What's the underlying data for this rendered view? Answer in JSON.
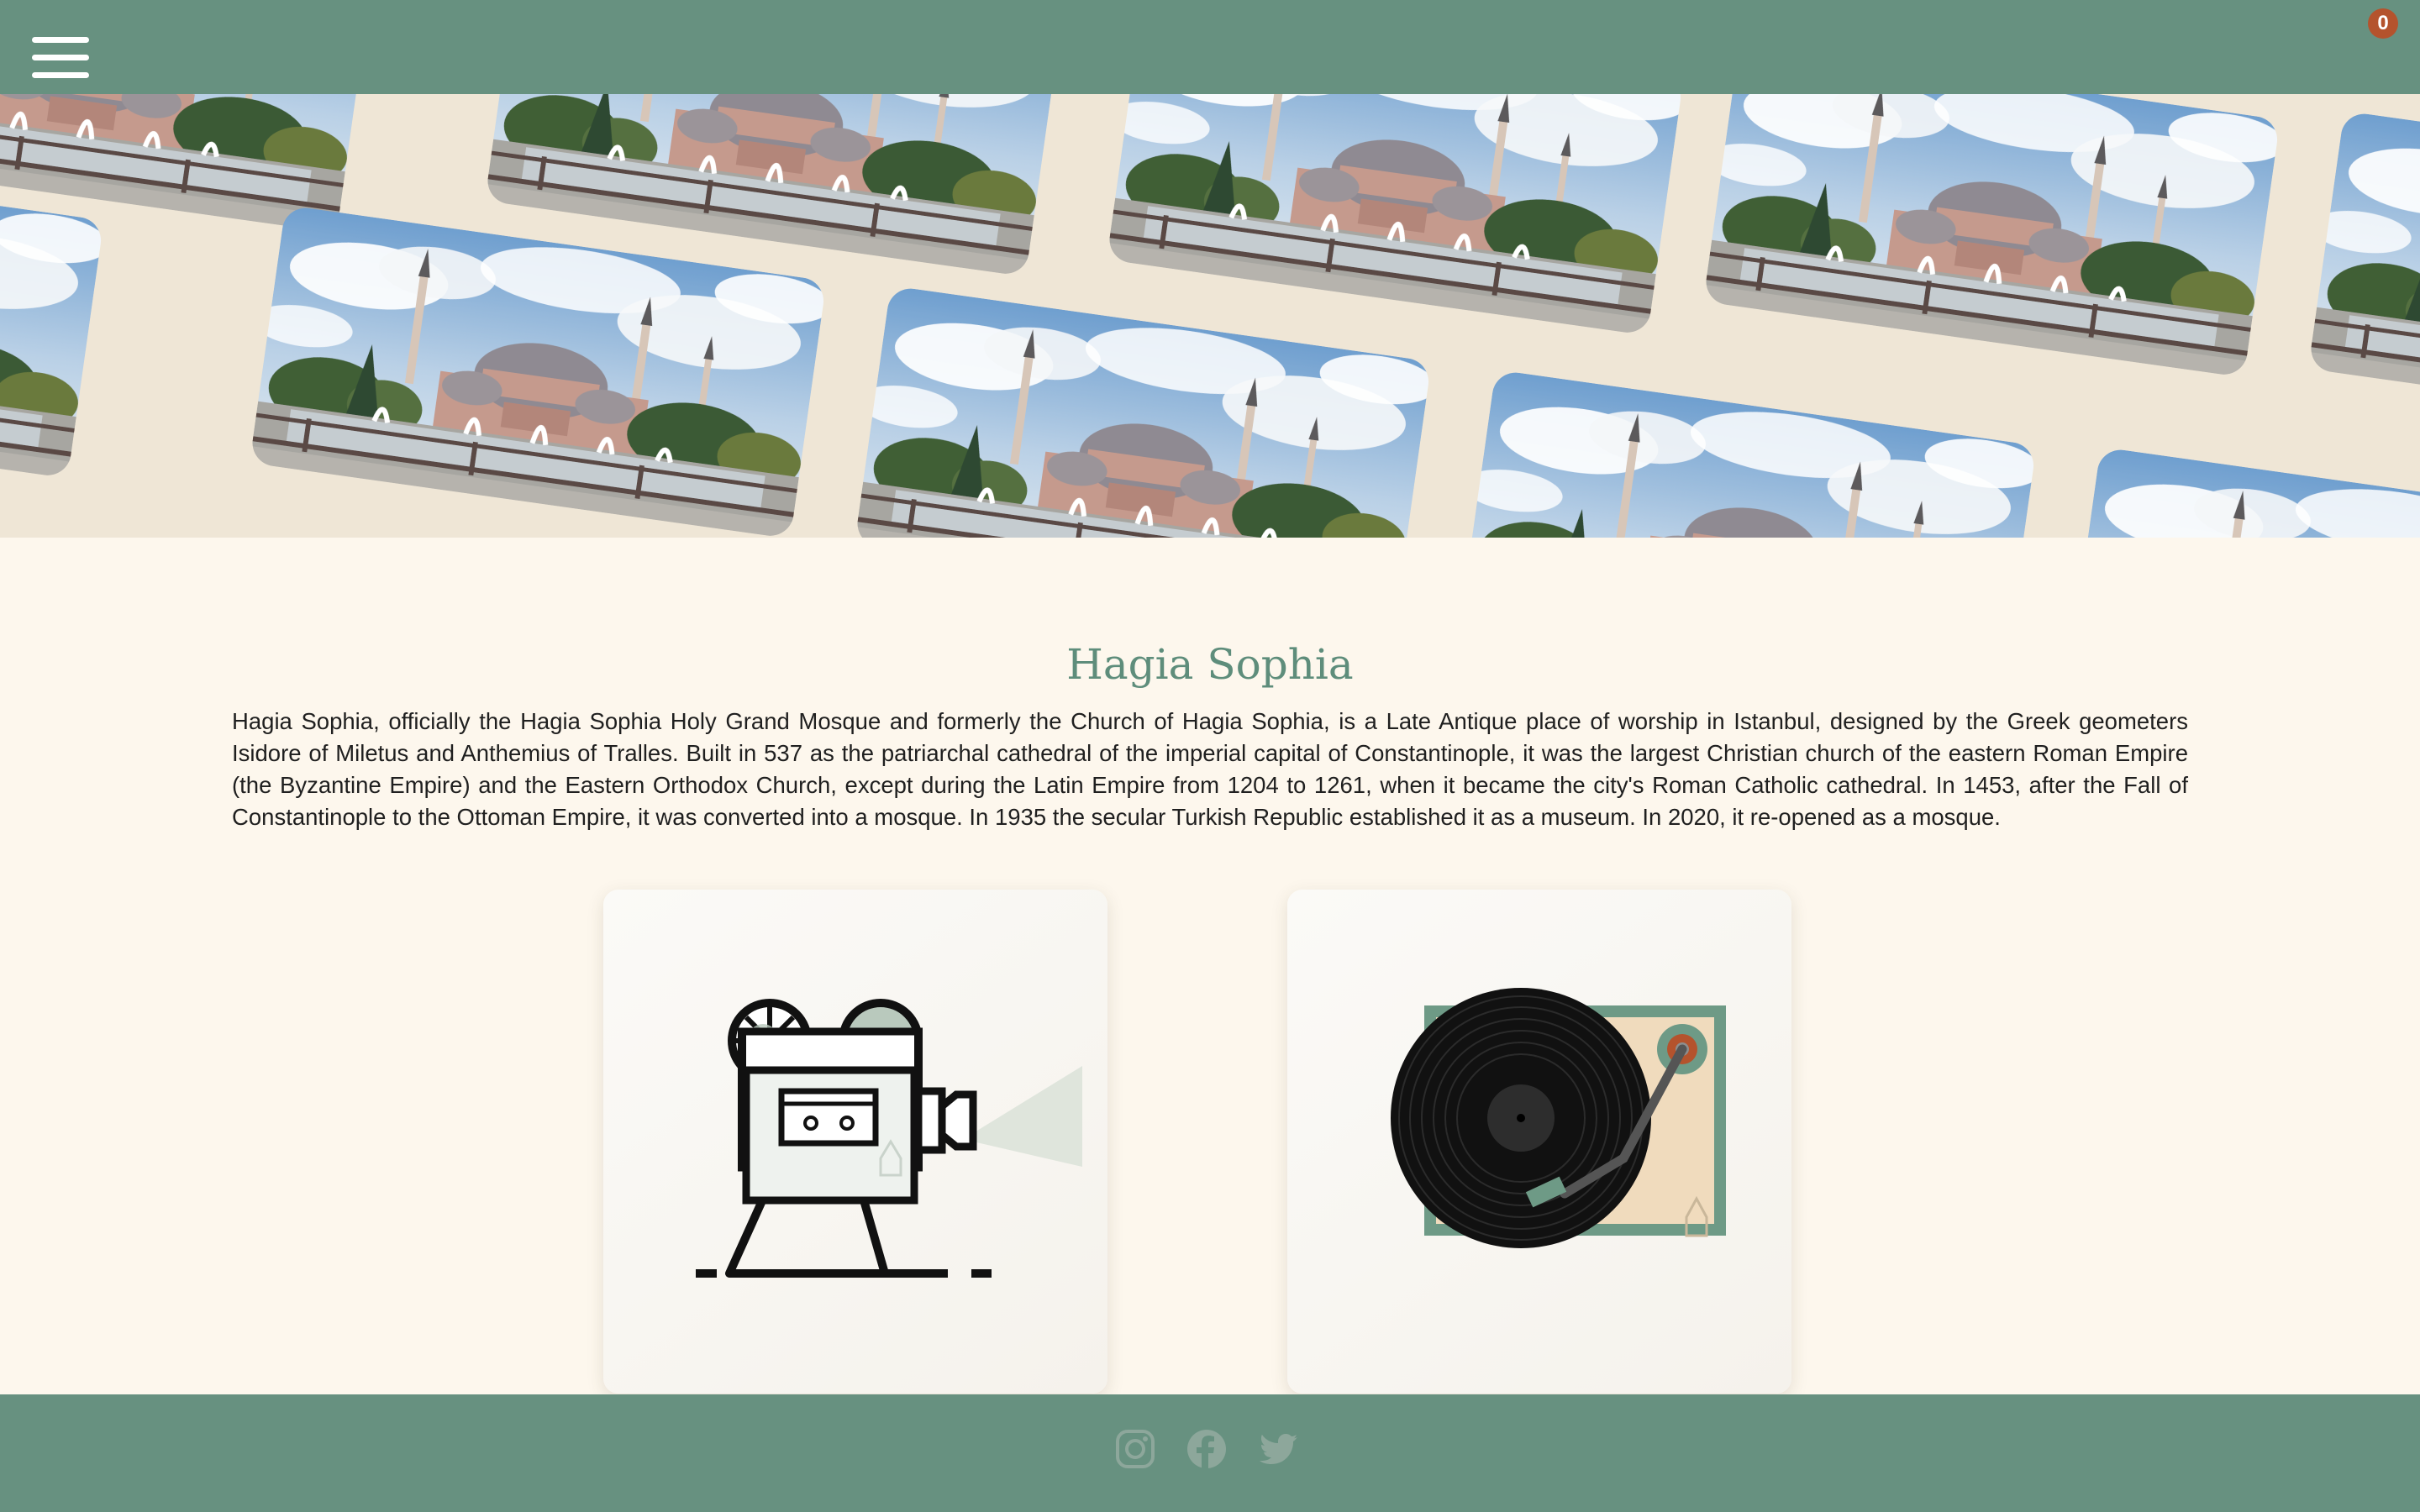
{
  "header": {
    "menu_icon": "hamburger-menu-icon",
    "avatar_icon": "user-avatar",
    "notification_count": "0"
  },
  "hero": {
    "image_subject": "Hagia Sophia photo collage"
  },
  "article": {
    "title": "Hagia Sophia",
    "description": "Hagia Sophia, officially the Hagia Sophia Holy Grand Mosque and formerly the Church of Hagia Sophia, is a Late Antique place of worship in Istanbul, designed by the Greek geometers Isidore of Miletus and Anthemius of Tralles. Built in 537 as the patriarchal cathedral of the imperial capital of Constantinople, it was the largest Christian church of the eastern Roman Empire (the Byzantine Empire) and the Eastern Orthodox Church, except during the Latin Empire from 1204 to 1261, when it became the city's Roman Catholic cathedral. In 1453, after the Fall of Constantinople to the Ottoman Empire, it was converted into a mosque. In 1935 the secular Turkish Republic established it as a museum. In 2020, it re-opened as a mosque."
  },
  "cards": [
    {
      "icon": "film-projector-icon"
    },
    {
      "icon": "record-player-icon"
    }
  ],
  "footer": {
    "social": [
      "instagram-icon",
      "facebook-icon",
      "twitter-icon"
    ]
  },
  "colors": {
    "accent": "#679180",
    "title": "#5e8d7b",
    "background": "#fdf7ed",
    "badge": "#b4532d"
  }
}
